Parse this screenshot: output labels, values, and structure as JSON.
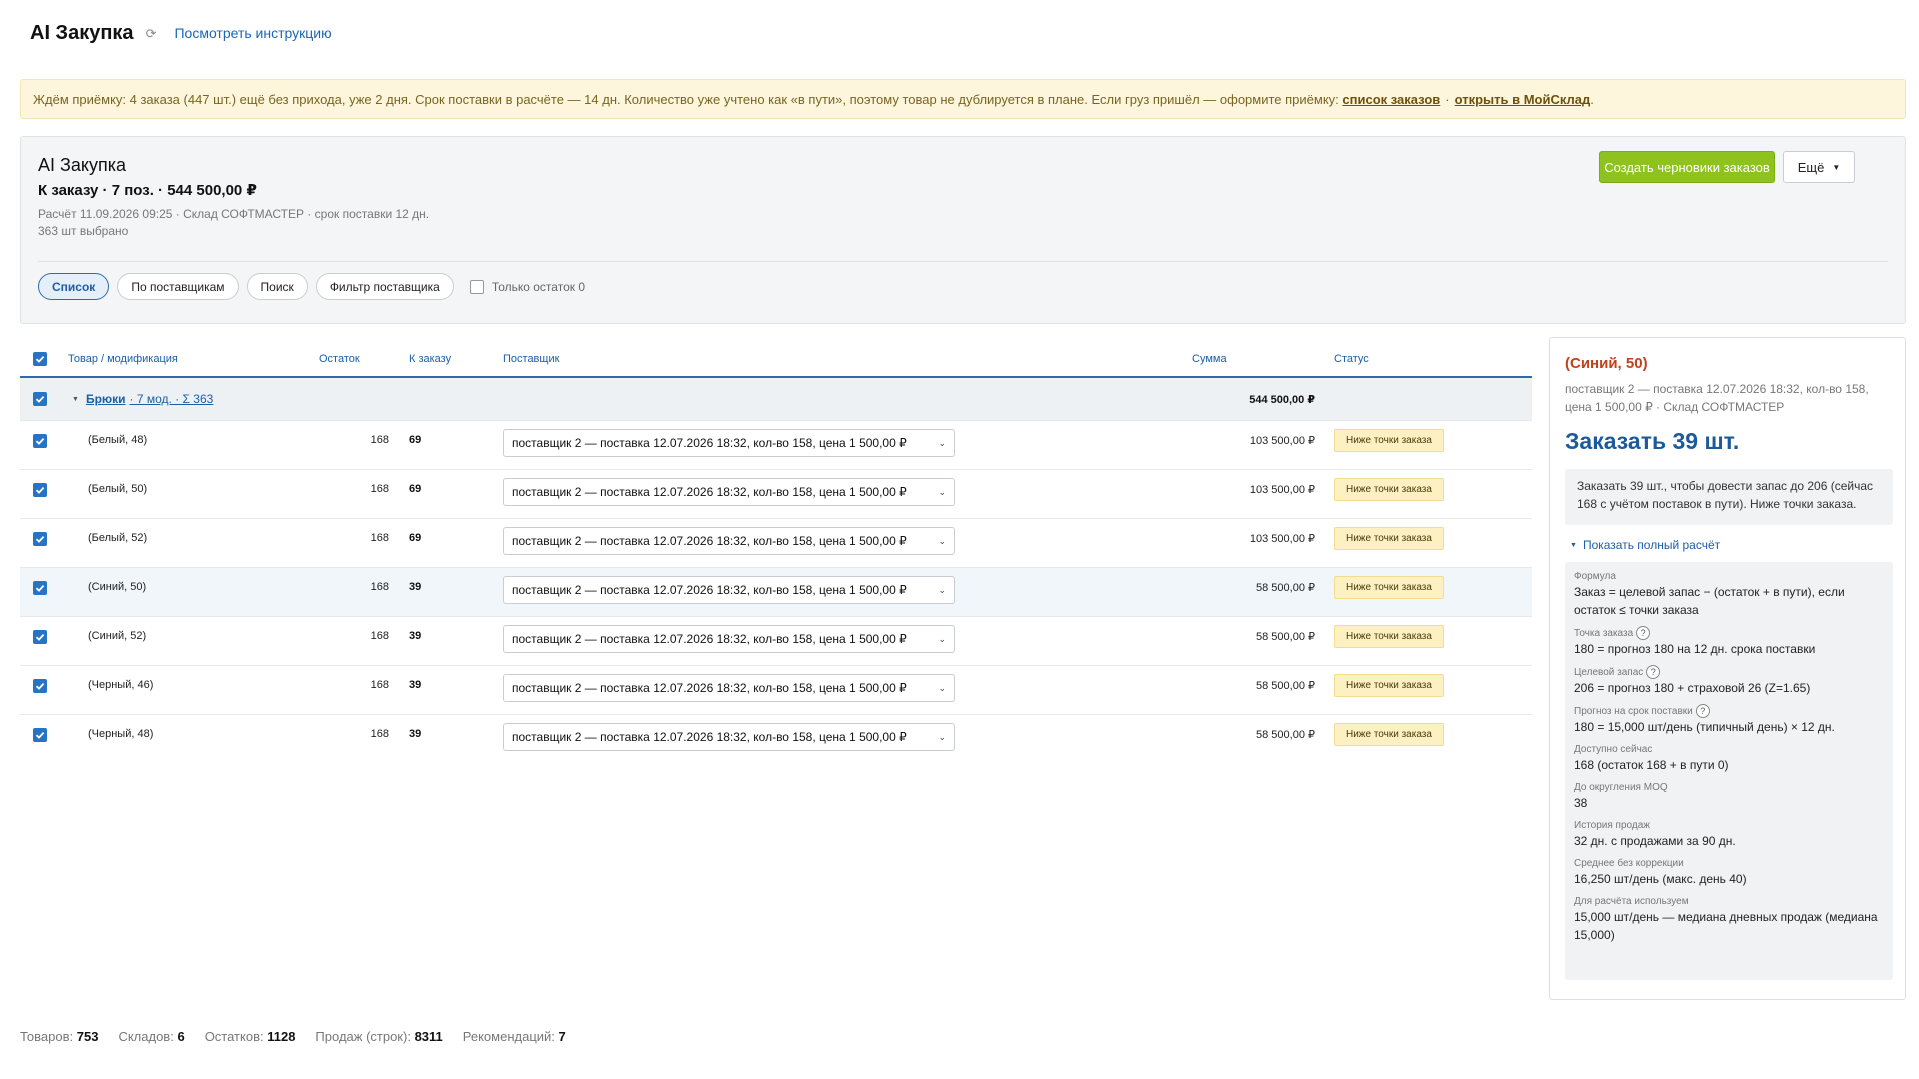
{
  "header": {
    "title": "AI Закупка",
    "refresh_icon": "refresh-icon",
    "help_link": "Посмотреть инструкцию"
  },
  "banner": {
    "text": "Ждём приёмку: 4 заказа (447 шт.) ещё без прихода, уже 2 дня. Срок поставки в расчёте — 14 дн. Количество уже учтено как «в пути», поэтому товар не дублируется в плане. Если груз пришёл — оформите приёмку:",
    "link_orders": "список заказов",
    "separator": "·",
    "link_moysklad": "открыть в МойСклад",
    "end": "."
  },
  "summary": {
    "title": "AI Закупка",
    "subtitle": "К заказу · 7 поз. · 544 500,00 ₽",
    "meta_line1": "Расчёт 11.09.2026 09:25 · Склад СОФТМАСТЕР · срок поставки 12 дн.",
    "meta_line2": "363 шт выбрано",
    "create_button": "Создать черновики заказов",
    "more_button": "Ещё",
    "tabs": [
      {
        "label": "Список",
        "active": true
      },
      {
        "label": "По поставщикам",
        "active": false
      },
      {
        "label": "Поиск",
        "active": false
      },
      {
        "label": "Фильтр поставщика",
        "active": false
      }
    ],
    "only_zero_label": "Только остаток 0"
  },
  "table": {
    "headers": {
      "product": "Товар / модификация",
      "stock": "Остаток",
      "to_order": "К заказу",
      "supplier": "Поставщик",
      "sum": "Сумма",
      "status": "Статус"
    },
    "group": {
      "name": "Брюки",
      "meta": "· 7 мод. · Σ 363",
      "sum": "544 500,00 ₽"
    },
    "rows": [
      {
        "name": "(Белый, 48)",
        "stock": "168",
        "order": "69",
        "supplier": "поставщик 2 — поставка 12.07.2026 18:32, кол-во 158, цена 1 500,00 ₽",
        "sum": "103 500,00 ₽",
        "status": "Ниже точки заказа"
      },
      {
        "name": "(Белый, 50)",
        "stock": "168",
        "order": "69",
        "supplier": "поставщик 2 — поставка 12.07.2026 18:32, кол-во 158, цена 1 500,00 ₽",
        "sum": "103 500,00 ₽",
        "status": "Ниже точки заказа"
      },
      {
        "name": "(Белый, 52)",
        "stock": "168",
        "order": "69",
        "supplier": "поставщик 2 — поставка 12.07.2026 18:32, кол-во 158, цена 1 500,00 ₽",
        "sum": "103 500,00 ₽",
        "status": "Ниже точки заказа"
      },
      {
        "name": "(Синий, 50)",
        "stock": "168",
        "order": "39",
        "supplier": "поставщик 2 — поставка 12.07.2026 18:32, кол-во 158, цена 1 500,00 ₽",
        "sum": "58 500,00 ₽",
        "status": "Ниже точки заказа"
      },
      {
        "name": "(Синий, 52)",
        "stock": "168",
        "order": "39",
        "supplier": "поставщик 2 — поставка 12.07.2026 18:32, кол-во 158, цена 1 500,00 ₽",
        "sum": "58 500,00 ₽",
        "status": "Ниже точки заказа"
      },
      {
        "name": "(Черный, 46)",
        "stock": "168",
        "order": "39",
        "supplier": "поставщик 2 — поставка 12.07.2026 18:32, кол-во 158, цена 1 500,00 ₽",
        "sum": "58 500,00 ₽",
        "status": "Ниже точки заказа"
      },
      {
        "name": "(Черный, 48)",
        "stock": "168",
        "order": "39",
        "supplier": "поставщик 2 — поставка 12.07.2026 18:32, кол-во 158, цена 1 500,00 ₽",
        "sum": "58 500,00 ₽",
        "status": "Ниже точки заказа"
      }
    ]
  },
  "detail": {
    "title": "(Синий, 50)",
    "subtitle": "поставщик 2 — поставка 12.07.2026 18:32, кол-во 158, цена 1 500,00 ₽ · Склад СОФТМАСТЕР",
    "big": "Заказать 39 шт.",
    "note": "Заказать 39 шт., чтобы довести запас до 206 (сейчас 168 с учётом поставок в пути). Ниже точки заказа.",
    "toggle": "Показать полный расчёт",
    "calc": [
      {
        "label": "Формула",
        "value": "Заказ = целевой запас − (остаток + в пути), если остаток ≤ точки заказа",
        "help": false
      },
      {
        "label": "Точка заказа",
        "value": "180 = прогноз 180 на 12 дн. срока поставки",
        "help": true
      },
      {
        "label": "Целевой запас",
        "value": "206 = прогноз 180 + страховой 26 (Z=1.65)",
        "help": true
      },
      {
        "label": "Прогноз на срок поставки",
        "value": "180 = 15,000 шт/день (типичный день) × 12 дн.",
        "help": true
      },
      {
        "label": "Доступно сейчас",
        "value": "168 (остаток 168 + в пути 0)",
        "help": false
      },
      {
        "label": "До округления MOQ",
        "value": "38",
        "help": false
      },
      {
        "label": "История продаж",
        "value": "32 дн. с продажами за 90 дн.",
        "help": false
      },
      {
        "label": "Среднее без коррекции",
        "value": "16,250 шт/день (макс. день 40)",
        "help": false
      },
      {
        "label": "Для расчёта используем",
        "value": "15,000 шт/день — медиана дневных продаж (медиана 15,000)",
        "help": false
      }
    ],
    "help_glyph": "?"
  },
  "footer": {
    "items": [
      {
        "label": "Товаров:",
        "value": "753"
      },
      {
        "label": "Складов:",
        "value": "6"
      },
      {
        "label": "Остатков:",
        "value": "1128"
      },
      {
        "label": "Продаж (строк):",
        "value": "8311"
      },
      {
        "label": "Рекомендаций:",
        "value": "7"
      }
    ]
  },
  "colors": {
    "accent": "#2b6cb0",
    "primary_button": "#8dc21f",
    "warning_bg": "#fdf6dc",
    "status_bg": "#fdf1c4",
    "detail_title": "#c0421b"
  }
}
